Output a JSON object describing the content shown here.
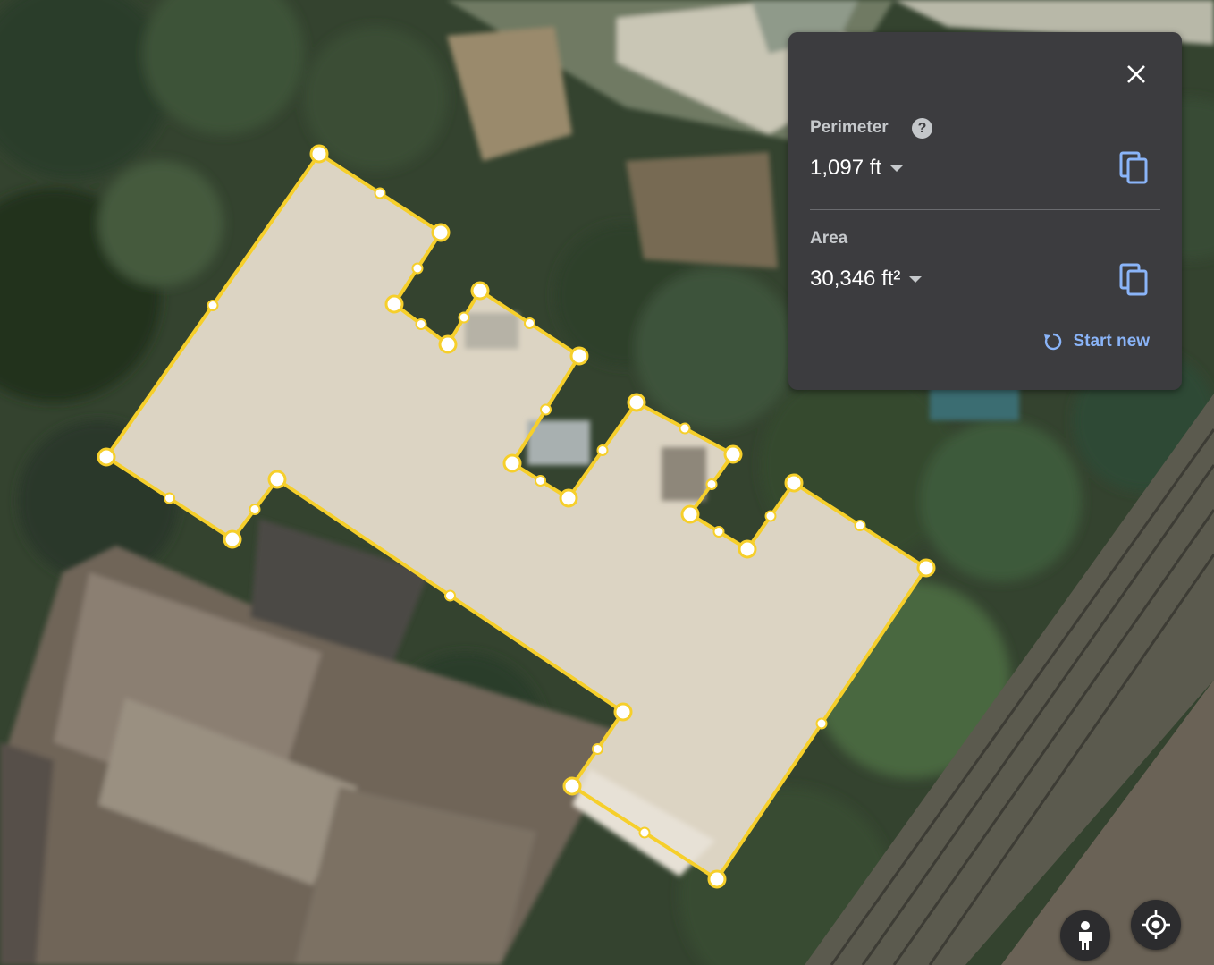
{
  "measurement": {
    "perimeter_label": "Perimeter",
    "perimeter_value": "1,097 ft",
    "area_label": "Area",
    "area_value": "30,346 ft²",
    "start_new_label": "Start new"
  },
  "icons": {
    "close": "close-icon",
    "help": "help-icon",
    "copy": "copy-icon",
    "refresh": "refresh-icon",
    "pegman": "pegman-icon",
    "my_location": "my-location-icon"
  },
  "colors": {
    "outline": "#f6cf2b",
    "panel": "#3c3c3f",
    "link": "#8ab4f8"
  }
}
